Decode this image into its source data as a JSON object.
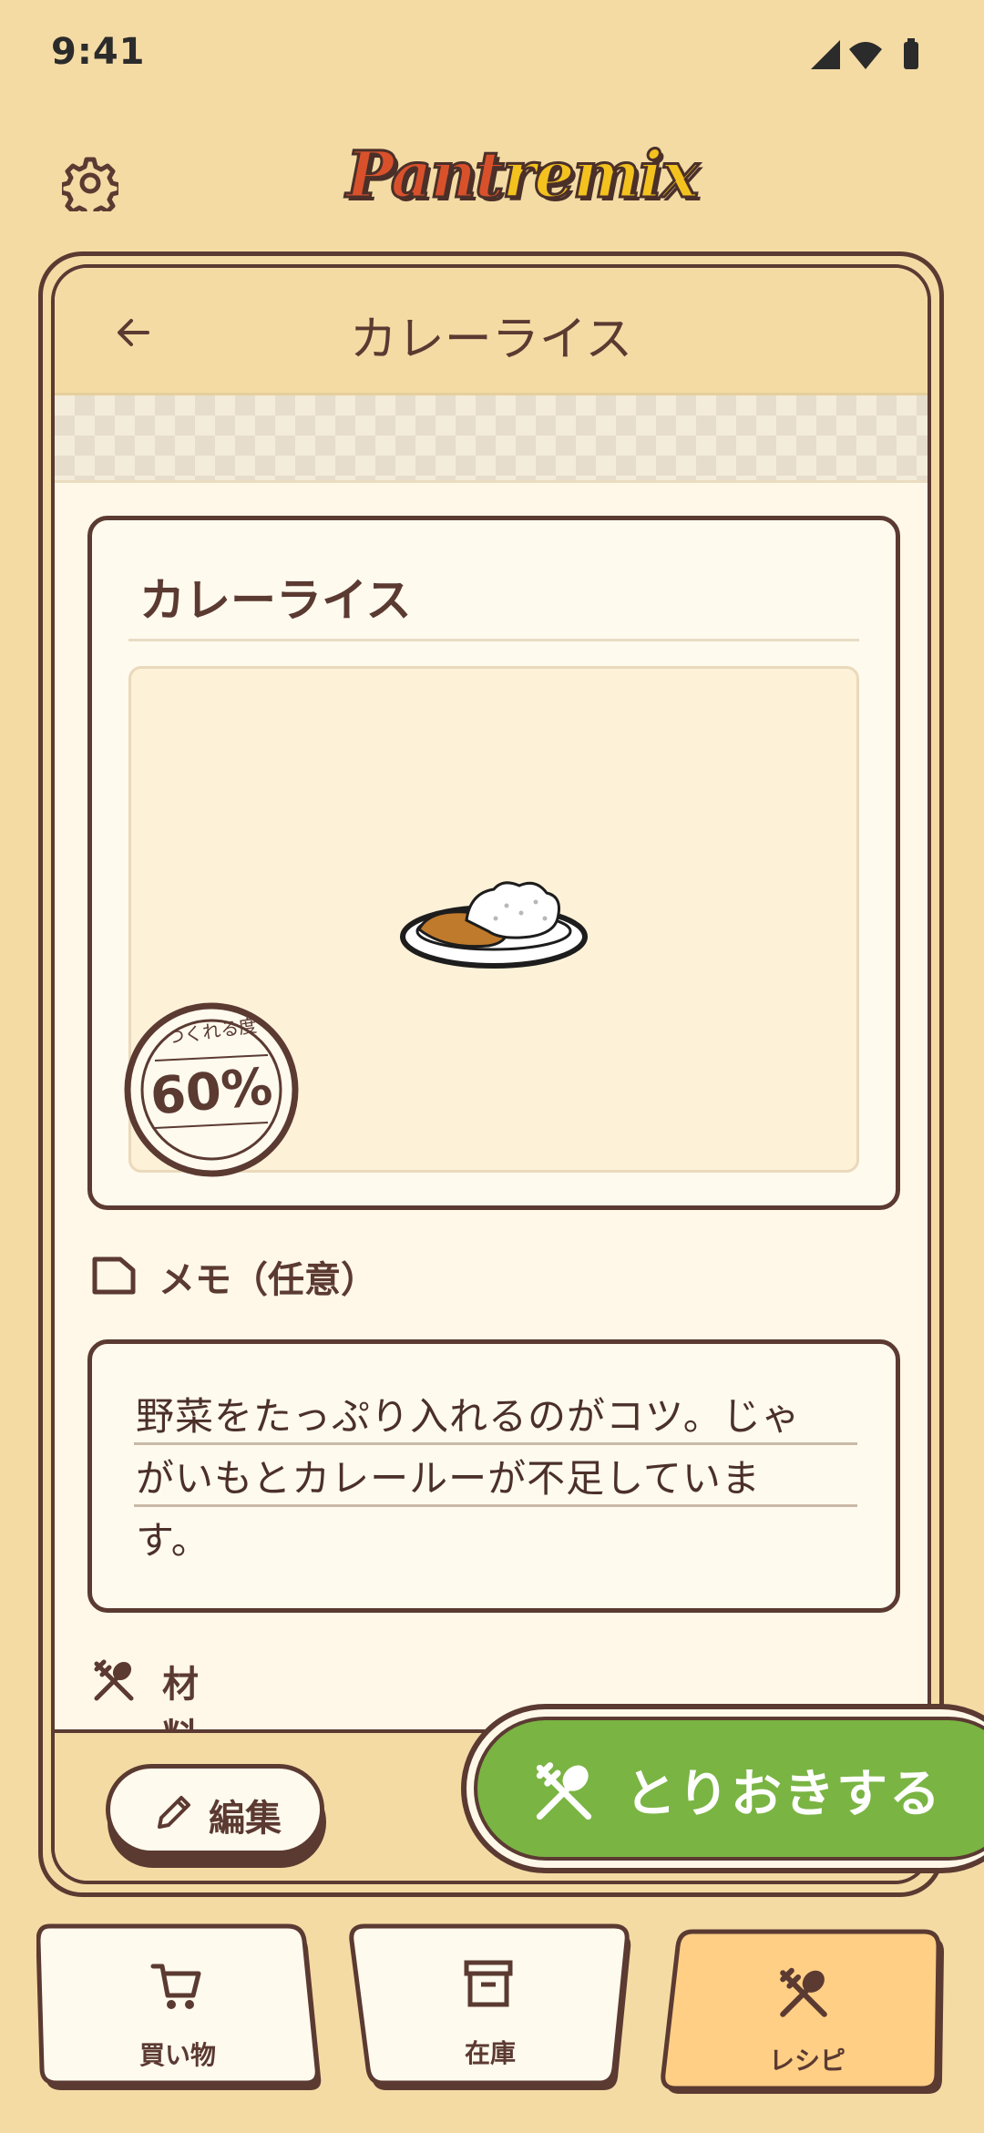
{
  "status": {
    "time": "9:41",
    "icons": [
      "signal-icon",
      "wifi-icon",
      "battery-icon"
    ]
  },
  "header": {
    "logo_part1": "Pant",
    "logo_part2": "remix",
    "settings_icon": "gear-icon"
  },
  "topbar": {
    "title": "カレーライス",
    "back_icon": "arrow-left-icon"
  },
  "recipe": {
    "title": "カレーライス",
    "image_icon": "curry-rice-illustration",
    "badge": {
      "caption": "つくれる度",
      "value": "60%",
      "percent": 60
    }
  },
  "memo": {
    "label": "メモ（任意）",
    "lines": [
      "野菜をたっぷり入れるのがコツ。じゃ",
      "がいもとカレールーが不足していま",
      "す。"
    ]
  },
  "ingredients": {
    "label": "材料"
  },
  "actions": {
    "edit_label": "編集",
    "save_label": "とりおきする"
  },
  "nav": {
    "items": [
      {
        "label": "買い物",
        "icon": "cart-icon"
      },
      {
        "label": "在庫",
        "icon": "archive-box-icon"
      },
      {
        "label": "レシピ",
        "icon": "fork-spoon-icon"
      }
    ],
    "active_index": 2
  },
  "colors": {
    "background": "#f4dba4",
    "ink": "#5b3a32",
    "accent_green": "#7ab443",
    "active_tab": "#ffcf85",
    "card": "#fffaee"
  }
}
